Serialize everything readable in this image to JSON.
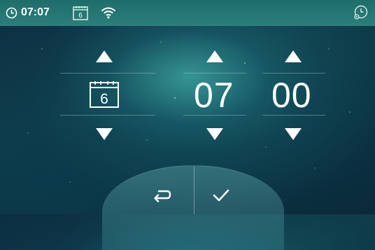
{
  "status_bar": {
    "time": "07:07",
    "calendar_day": "6",
    "icons": [
      "clock-icon",
      "calendar-icon",
      "wifi-icon",
      "clock-settings-icon"
    ]
  },
  "picker": {
    "day": "6",
    "hour": "07",
    "minute": "00",
    "controls": [
      "up-arrow",
      "down-arrow"
    ]
  },
  "actions": {
    "icons": [
      "return-icon",
      "checkmark-icon"
    ]
  },
  "colors": {
    "status_bar_bg": "#267672",
    "accent_glow": "#5ccfc2",
    "background": "#0d3444",
    "foreground": "#ffffff"
  }
}
